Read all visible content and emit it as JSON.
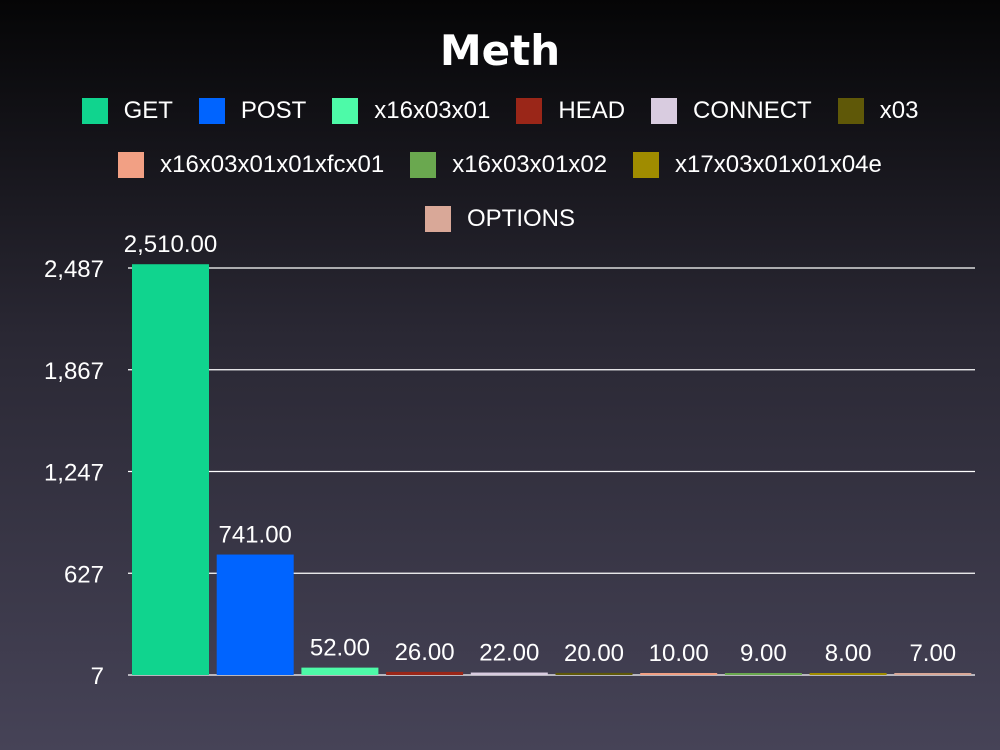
{
  "chart_data": {
    "type": "bar",
    "title": "Meth",
    "xlabel": "",
    "ylabel": "",
    "categories": [
      "GET",
      "POST",
      "x16x03x01",
      "HEAD",
      "CONNECT",
      "x03",
      "x16x03x01x01xfcx01",
      "x16x03x01x02",
      "x17x03x01x01x04e",
      "OPTIONS"
    ],
    "values": [
      2510,
      741,
      52,
      26,
      22,
      20,
      10,
      9,
      8,
      7
    ],
    "data_labels": [
      "2,510.00",
      "741.00",
      "52.00",
      "26.00",
      "22.00",
      "20.00",
      "10.00",
      "9.00",
      "8.00",
      "7.00"
    ],
    "colors": [
      "#10d48e",
      "#0064ff",
      "#4dfaa8",
      "#9a2618",
      "#d9cce0",
      "#5f5808",
      "#f2a084",
      "#6aa84f",
      "#a08c00",
      "#d9a898"
    ],
    "yticks": [
      7,
      627,
      1247,
      1867,
      2487
    ],
    "ytick_labels": [
      "7",
      "627",
      "1,247",
      "1,867",
      "2,487"
    ],
    "ylim": [
      7,
      2487
    ],
    "grid": true,
    "legend_position": "top"
  }
}
